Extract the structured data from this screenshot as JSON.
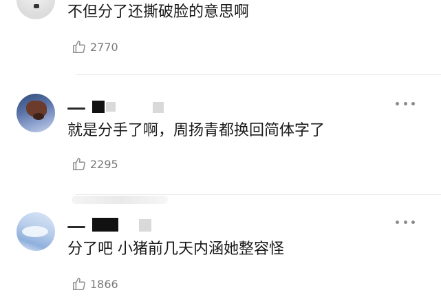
{
  "comments": [
    {
      "text": "不但分了还撕破脸的意思啊",
      "likes": "2770",
      "avatar_icon": "user-avatar"
    },
    {
      "text": "就是分手了啊，周扬青都换回简体字了",
      "likes": "2295",
      "avatar_icon": "user-avatar"
    },
    {
      "text": "分了吧 小猪前几天内涵她整容怪",
      "likes": "1866",
      "avatar_icon": "user-avatar"
    }
  ],
  "icons": {
    "like": "thumbs-up-icon",
    "more": "more-options-icon"
  },
  "colors": {
    "text": "#1a1a1a",
    "meta": "#7a7a7a",
    "divider": "#e6e6e6",
    "redaction": "#111111"
  }
}
